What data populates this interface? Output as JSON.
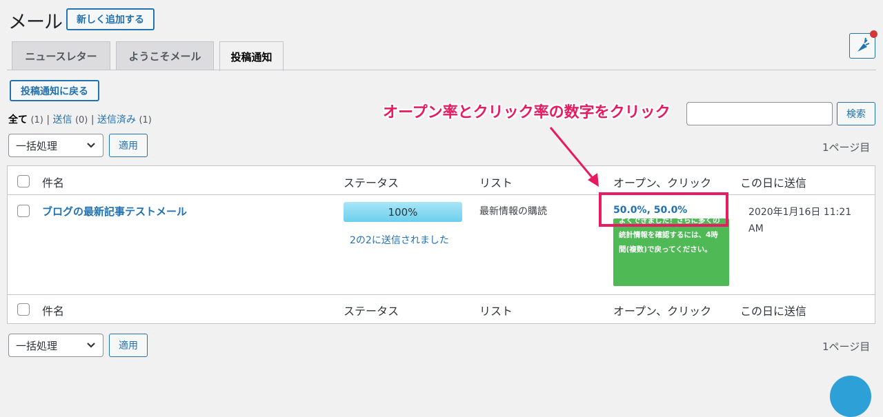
{
  "header": {
    "title": "メール",
    "add_new_label": "新しく追加する"
  },
  "tabs": [
    {
      "label": "ニュースレター",
      "active": false
    },
    {
      "label": "ようこそメール",
      "active": false
    },
    {
      "label": "投稿通知",
      "active": true
    }
  ],
  "back_button_label": "投稿通知に戻る",
  "filters": {
    "all_label": "全て",
    "all_count": "(1)",
    "sent_label": "送信",
    "sent_count": "(0)",
    "delivered_label": "送信済み",
    "delivered_count": "(1)",
    "separator": "|"
  },
  "search": {
    "button_label": "検索",
    "value": ""
  },
  "bulk_top": {
    "select_value": "一括処理",
    "apply_label": "適用",
    "pages": "1ページ目"
  },
  "bulk_bottom": {
    "select_value": "一括処理",
    "apply_label": "適用",
    "pages": "1ページ目"
  },
  "table": {
    "columns": [
      "件名",
      "ステータス",
      "リスト",
      "オープン、クリック",
      "この日に送信"
    ],
    "rows": [
      {
        "subject": "ブログの最新記事テストメール",
        "status_progress": "100%",
        "status_note": "2の2に送信されました",
        "list": "最新情報の購読",
        "rates": "50.0%, 50.0%",
        "sent_date": "2020年1月16日 11:21 AM"
      }
    ]
  },
  "tooltip": {
    "text": "よくできました！さらに多くの統計情報を確認するには、4時間(複数)で戻ってください。"
  },
  "annotation": {
    "text": "オープン率とクリック率の数字をクリック",
    "color": "#e9195f"
  },
  "colors": {
    "link": "#2271b1",
    "tooltip_bg": "#4fb956",
    "highlight": "#ea1a63"
  },
  "icons": {
    "fab": "carrot-icon",
    "select": "chevron-down-icon"
  }
}
